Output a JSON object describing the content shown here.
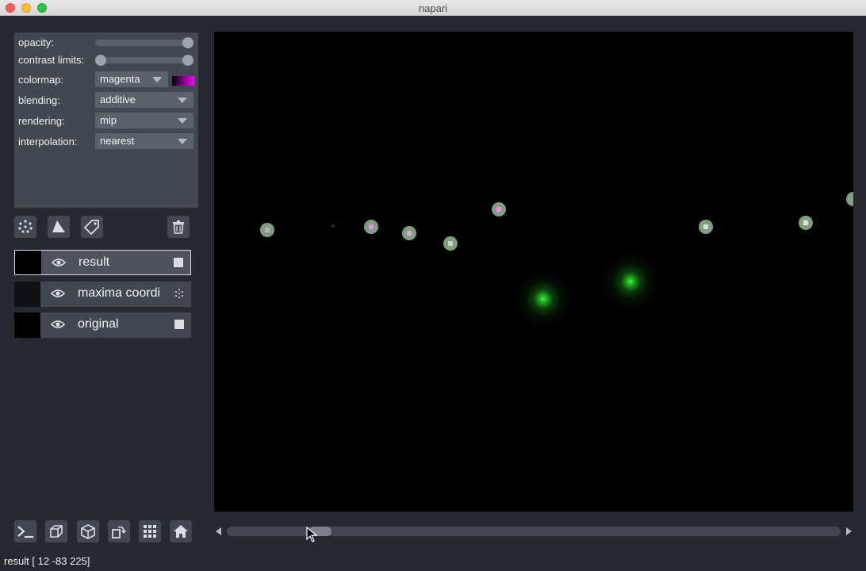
{
  "window": {
    "title": "napari"
  },
  "controls": {
    "opacity_label": "opacity:",
    "contrast_label": "contrast limits:",
    "colormap_label": "colormap:",
    "colormap_value": "magenta",
    "blending_label": "blending:",
    "blending_value": "additive",
    "rendering_label": "rendering:",
    "rendering_value": "mip",
    "interpolation_label": "interpolation:",
    "interpolation_value": "nearest",
    "opacity": 1.0,
    "contrast_limits": [
      0,
      1
    ]
  },
  "layers": [
    {
      "name": "result",
      "selected": true,
      "type": "image"
    },
    {
      "name": "maxima coordi",
      "selected": false,
      "type": "points"
    },
    {
      "name": "original",
      "selected": false,
      "type": "image"
    }
  ],
  "status": {
    "text": "result [ 12 -83 225]"
  },
  "colors": {
    "accent_magenta": "#ff00ff",
    "point_face": "#7f9f7f",
    "glow_green": "#38ff38"
  },
  "icons": [
    "points-icon",
    "shapes-icon",
    "labels-icon",
    "trash-icon",
    "eye-icon",
    "console-icon",
    "ndisplay-icon",
    "transpose-icon",
    "roll-icon",
    "grid-icon",
    "home-icon"
  ]
}
